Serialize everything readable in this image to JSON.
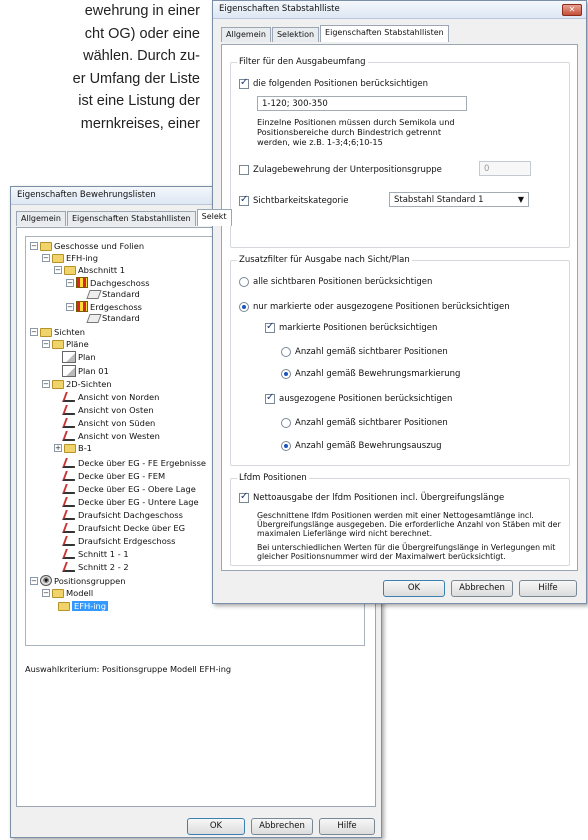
{
  "doc_text": {
    "lines": [
      "ewehrung in einer",
      "cht OG) oder eine",
      "wählen. Durch zu-",
      "er Umfang der Liste",
      "ist eine Listung der",
      "mernkreises, einer"
    ]
  },
  "back": {
    "title": "Eigenschaften Bewehrungslisten",
    "tabs": [
      "Allgemein",
      "Eigenschaften Stabstahllisten",
      "Selekt"
    ],
    "tree": {
      "geschosse": "Geschosse und Folien",
      "efh": "EFH-ing",
      "abschnitt": "Abschnitt 1",
      "dachgeschoss": "Dachgeschoss",
      "standard1": "Standard",
      "erdgeschoss": "Erdgeschoss",
      "standard2": "Standard",
      "sichten": "Sichten",
      "plaene": "Pläne",
      "plan": "Plan",
      "plan01": "Plan 01",
      "sichten2d": "2D-Sichten",
      "views": [
        "Ansicht von Norden",
        "Ansicht von Osten",
        "Ansicht von Süden",
        "Ansicht von Westen"
      ],
      "b1": "B-1",
      "views2": [
        "Decke über EG - FE Ergebnisse",
        "Decke über EG - FEM",
        "Decke über EG - Obere Lage",
        "Decke über EG - Untere Lage",
        "Draufsicht Dachgeschoss",
        "Draufsicht Decke über EG",
        "Draufsicht Erdgeschoss",
        "Schnitt 1 - 1",
        "Schnitt 2 - 2"
      ],
      "positionsgruppen": "Positionsgruppen",
      "modell": "Modell",
      "efh2": "EFH-ing"
    },
    "criterion": "Auswahlkriterium: Positionsgruppe Modell EFH-ing",
    "ok": "OK",
    "cancel": "Abbrechen",
    "help": "Hilfe"
  },
  "front": {
    "title": "Eigenschaften Stabstahlliste",
    "close": "✕",
    "tabs": [
      "Allgemein",
      "Selektion",
      "Eigenschaften Stabstahllisten"
    ],
    "filter": {
      "legend": "Filter für den Ausgabeumfang",
      "positions_label": "die folgenden Positionen berücksichtigen",
      "positions_value": "1-120; 300-350",
      "hint": [
        "Einzelne Positionen müssen durch Semikola und",
        "Positionsbereiche durch Bindestrich getrennt",
        "werden, wie z.B. 1-3;4;6;10-15"
      ],
      "zulage_label": "Zulagebewehrung der Unterpositionsgruppe",
      "zulage_value": "0",
      "sicht_label": "Sichtbarkeitskategorie",
      "sicht_value": "Stabstahl Standard 1"
    },
    "zusatz": {
      "legend": "Zusatzfilter für Ausgabe nach Sicht/Plan",
      "all": "alle sichtbaren Positionen berücksichtigen",
      "marked_or_drawn": "nur markierte oder ausgezogene Positionen berücksichtigen",
      "marked": "markierte Positionen berücksichtigen",
      "marked_a": "Anzahl gemäß sichtbarer Positionen",
      "marked_b": "Anzahl gemäß Bewehrungsmarkierung",
      "drawn": "ausgezogene Positionen berücksichtigen",
      "drawn_a": "Anzahl gemäß sichtbarer Positionen",
      "drawn_b": "Anzahl gemäß Bewehrungsauszug"
    },
    "lfdm": {
      "legend": "Lfdm Positionen",
      "net_label": "Nettoausgabe der lfdm Positionen incl. Übergreifungslänge",
      "p1": [
        "Geschnittene lfdm Positionen werden mit einer Nettogesamtlänge incl.",
        "Übergreifungslänge ausgegeben. Die erforderliche Anzahl von Stäben mit der",
        "maximalen Lieferlänge wird nicht berechnet."
      ],
      "p2": [
        "Bei unterschiedlichen Werten für die Übergreifungslänge in Verlegungen mit",
        "gleicher Positionsnummer wird der Maximalwert berücksichtigt."
      ]
    },
    "ok": "OK",
    "cancel": "Abbrechen",
    "help": "Hilfe"
  }
}
